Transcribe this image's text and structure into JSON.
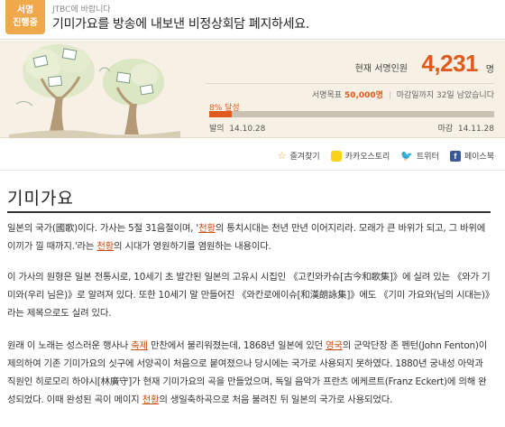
{
  "header": {
    "badge_line1": "서명",
    "badge_line2": "진행중",
    "recipient": "JTBC에 바랍니다",
    "title": "기미가요를 방송에 내보낸 비정상회담 폐지하세요."
  },
  "petition": {
    "count_label": "현재 서명인원",
    "count": "4,231",
    "count_unit": "명",
    "goal_label": "서명목표",
    "goal_value": "50,000명",
    "remaining_label": "마감일까지",
    "remaining_value": "32일",
    "remaining_suffix": "남았습니다",
    "percent_text": "8% 달성",
    "progress_fraction": 0.08,
    "start_label": "발의",
    "start_date": "14.10.28",
    "end_label": "마감",
    "end_date": "14.11.28",
    "accent_color": "#e05a1e"
  },
  "share": {
    "favorite": "즐겨찾기",
    "kakaostory": "카카오스토리",
    "twitter": "트위터",
    "facebook": "페이스북",
    "icons": [
      "star-icon",
      "kakaostory-icon",
      "twitter-icon",
      "facebook-icon"
    ]
  },
  "article": {
    "title": "기미가요",
    "p1": [
      {
        "t": "일본의 국가(國歌)이다. 가사는 5절 31음절이며, '"
      },
      {
        "t": "천황",
        "link": true
      },
      {
        "t": "의 통치시대는 천년 만년 이어지리라. 모래가 큰 바위가 되고, 그 바위에 이끼가 낄 때까지.'라는 "
      },
      {
        "t": "천황",
        "link": true
      },
      {
        "t": "의 시대가 영원하기를 염원하는 내용이다."
      }
    ],
    "p2": [
      {
        "t": "이 가사의 원형은 일본 전통시로, 10세기 초 발간된 일본의 고유시 시집인 《고킨와카슈[古今和歌集]》에 실려 있는 《와가 기미와(우리 님은)》로 알려져 있다. 또한 10세기 말 만들어진 《와칸로에이슈[和漢朗詠集]》에도 《기미 가요와(님의 시대는)》라는 제목으로도 실려 있다."
      }
    ],
    "p3": [
      {
        "t": "원래 이 노래는 성스러운 행사나 "
      },
      {
        "t": "축제",
        "link": true
      },
      {
        "t": " 만찬에서 불리워졌는데, 1868년 일본에 있던 "
      },
      {
        "t": "영국",
        "link": true
      },
      {
        "t": "의 군악단장 존 펜턴(John Fenton)이 제의하여 기존 기미가요의 싯구에 서양곡이 처음으로 붙여졌으나 당시에는 국가로 사용되지 못하였다. 1880년 궁내성 아악과 직원인 히로모리 하야시[林廣守]가 현재 기미가요의 곡을 만들었으며, 독일 음악가 프란츠 에케르트(Franz Eckert)에 의해 완성되었다. 이때 완성된 곡이 메이지 "
      },
      {
        "t": "천황",
        "link": true
      },
      {
        "t": "의 생일축하곡으로 처음 불려진 뒤 일본의 국가로 사용되었다."
      }
    ]
  }
}
